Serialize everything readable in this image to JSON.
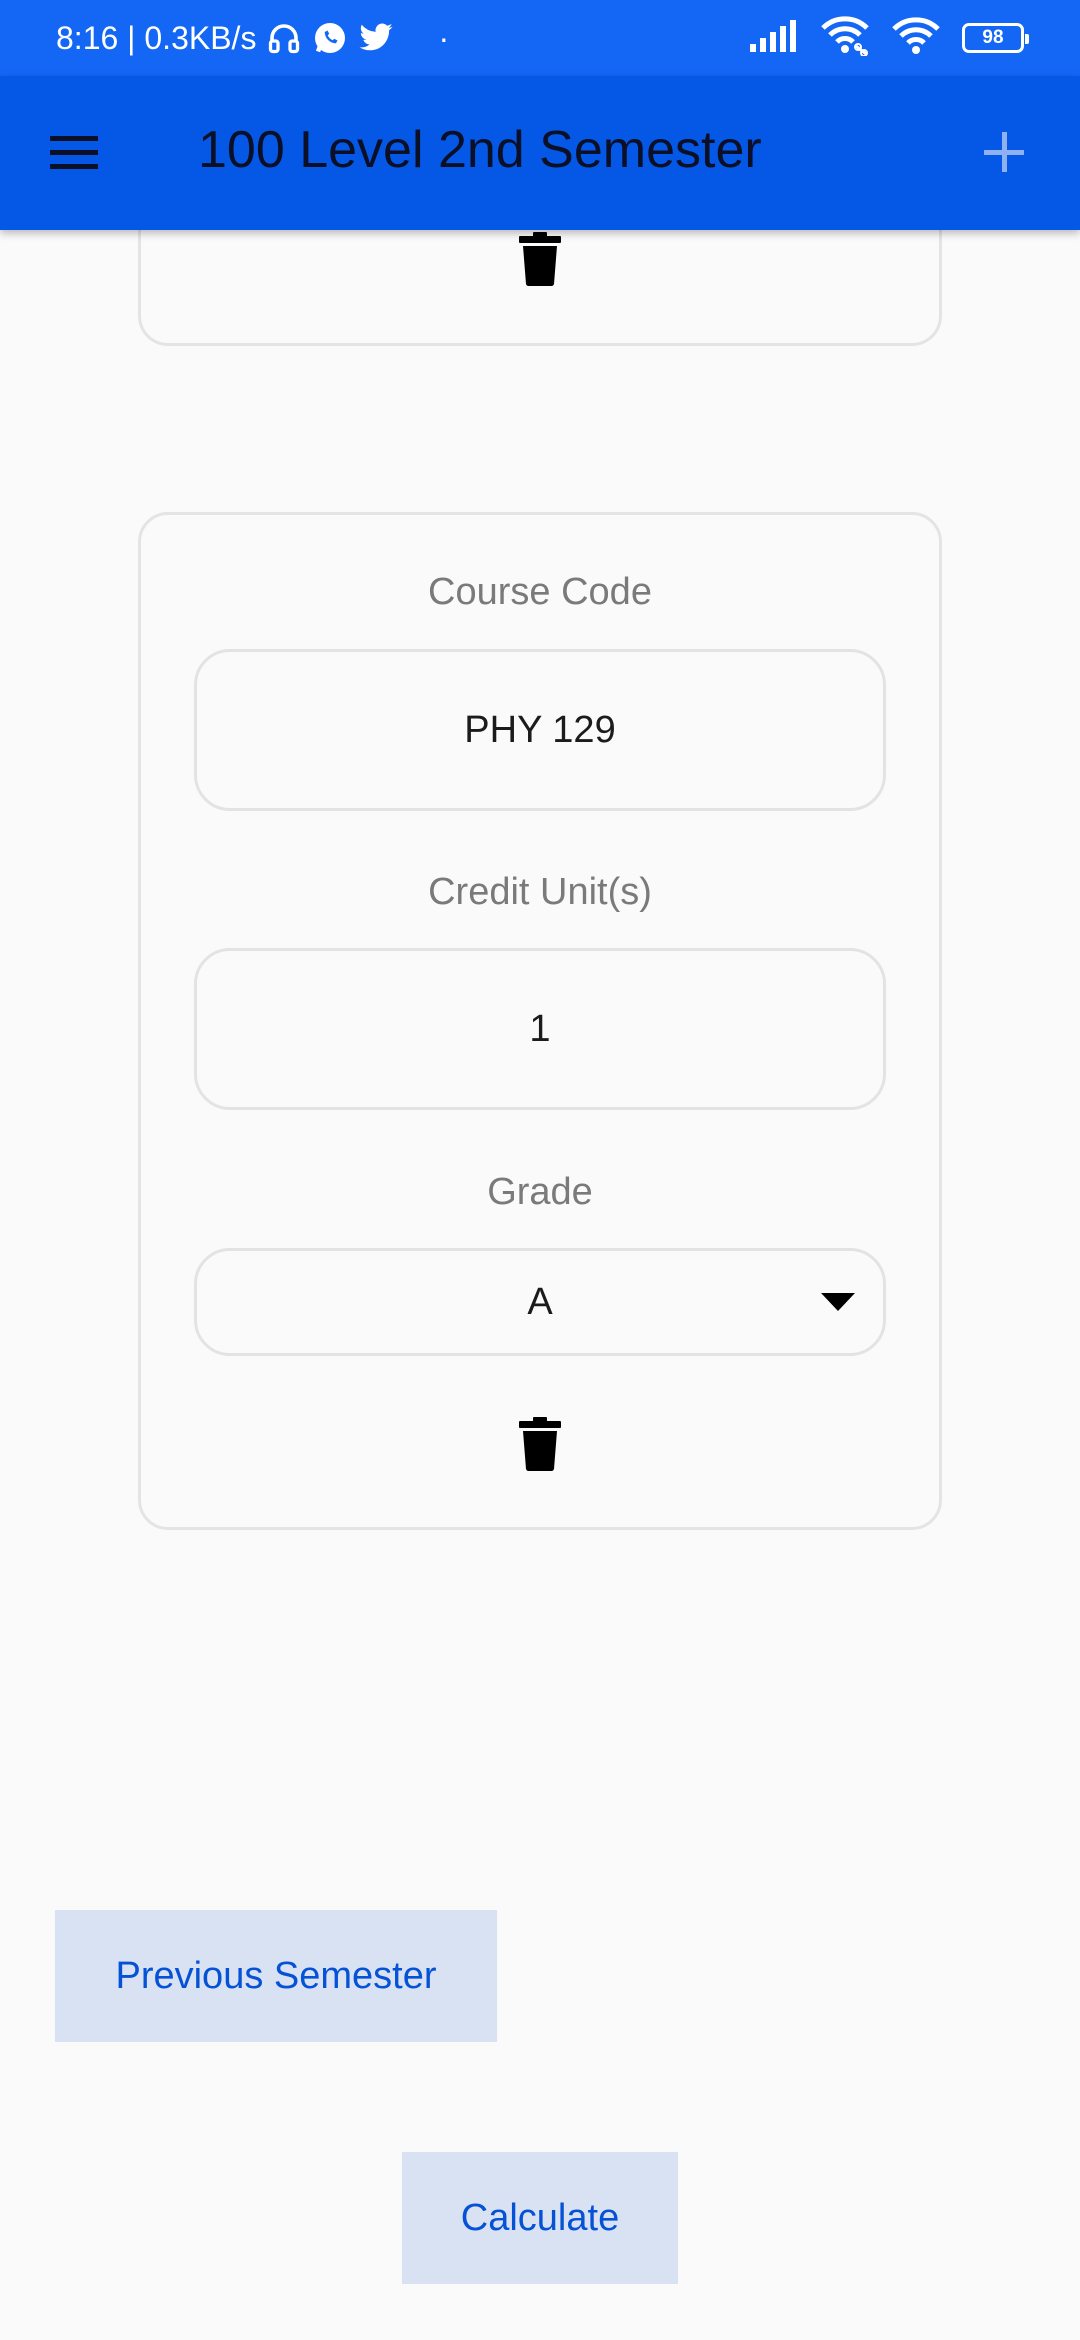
{
  "status_bar": {
    "time_speed": "8:16 | 0.3KB/s",
    "dot": "·",
    "battery": "98",
    "icons": [
      "headphones-icon",
      "whatsapp-icon",
      "twitter-icon",
      "cell-signal-icon",
      "wifi-linked-icon",
      "wifi-icon",
      "battery-icon"
    ]
  },
  "app_bar": {
    "title": "100 Level 2nd Semester",
    "menu_icon": "hamburger-menu-icon",
    "add_icon": "plus-icon",
    "color": "#0557e6"
  },
  "course_card": {
    "course_code_label": "Course Code",
    "course_code_value": "PHY 129",
    "credit_units_label": "Credit Unit(s)",
    "credit_units_value": "1",
    "grade_label": "Grade",
    "grade_value": "A",
    "delete_icon": "trash-icon"
  },
  "buttons": {
    "previous_semester": "Previous Semester",
    "calculate": "Calculate"
  },
  "colors": {
    "status_bar": "#1467f5",
    "button_bg": "#d8e2f3",
    "button_text": "#0552d6"
  }
}
